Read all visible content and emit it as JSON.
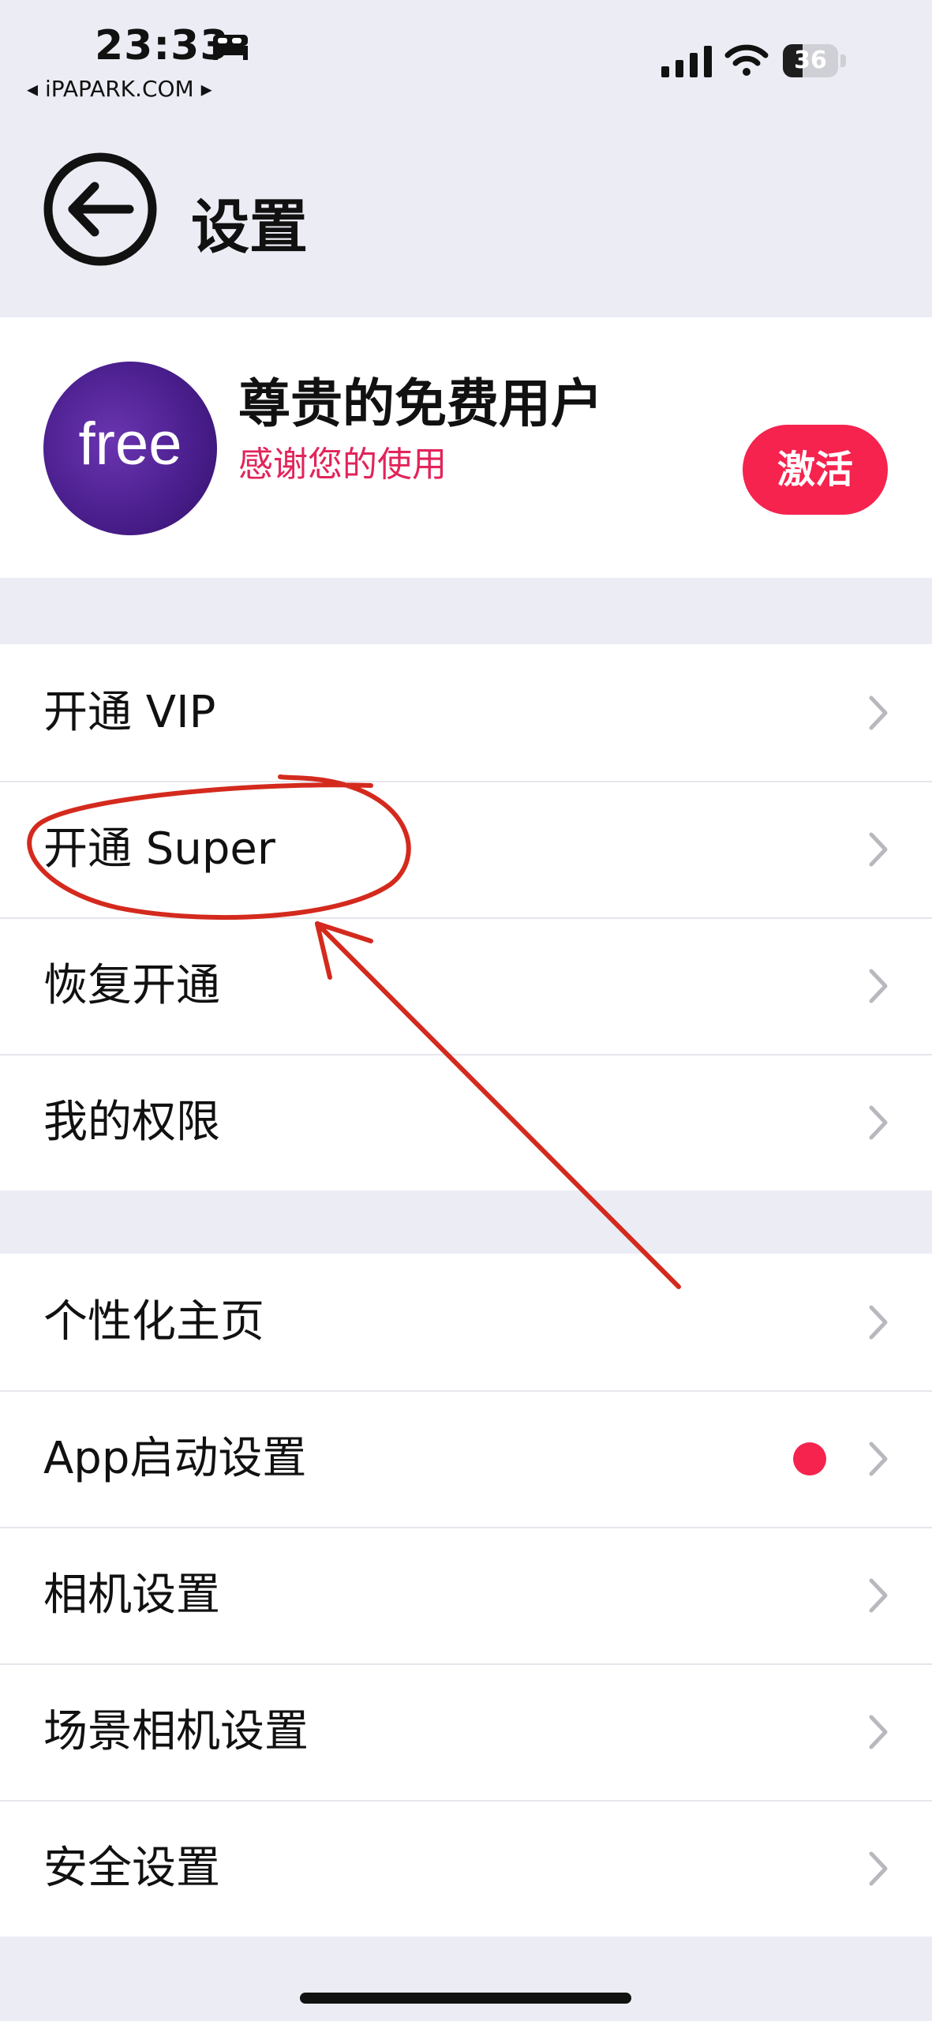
{
  "status_bar": {
    "time": "23:33",
    "back_app": "◂ iPAPARK.COM ▸",
    "battery": "36",
    "battery_level": 0.36
  },
  "nav": {
    "title": "设置"
  },
  "profile": {
    "avatar_text": "free",
    "name": "尊贵的免费用户",
    "subtitle": "感谢您的使用",
    "activate_label": "激活"
  },
  "groups": {
    "purchase": [
      {
        "label": "开通 VIP"
      },
      {
        "label": "开通 Super"
      },
      {
        "label": "恢复开通"
      },
      {
        "label": "我的权限"
      }
    ],
    "settings": [
      {
        "label": "个性化主页"
      },
      {
        "label": "App启动设置"
      },
      {
        "label": "相机设置"
      },
      {
        "label": "场景相机设置"
      },
      {
        "label": "安全设置"
      }
    ]
  },
  "colors": {
    "accent": "#f5234e",
    "annotation": "#d42a1e",
    "background": "#ececf5"
  }
}
